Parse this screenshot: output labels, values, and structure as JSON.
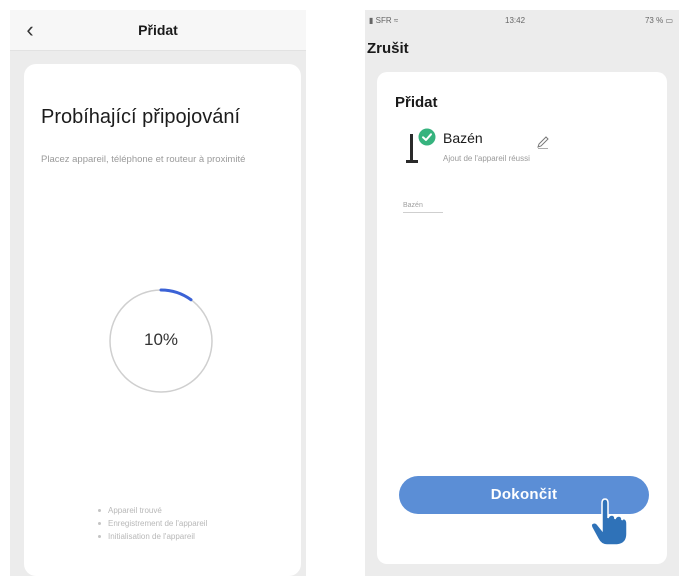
{
  "left_screen": {
    "back_icon": "chevron-left-icon",
    "header_title": "Přidat",
    "heading": "Probíhající připojování",
    "subtitle": "Placez appareil, téléphone et routeur à proximité",
    "progress_percent": 10,
    "progress_label": "10%",
    "progress_color": "#3b62d6",
    "steps": [
      "Appareil trouvé",
      "Enregistrement de l'appareil",
      "Initialisation de l'appareil"
    ]
  },
  "right_screen": {
    "status": {
      "carrier": "SFR",
      "time": "13:42",
      "battery": "73 %"
    },
    "cancel_label": "Zrušit",
    "add_title": "Přidat",
    "device": {
      "icon": "pool-lamp-icon",
      "name": "Bazén",
      "status": "Ajout de l'appareil réussi",
      "success_color": "#36b37e"
    },
    "room_label": "Bazén",
    "done_label": "Dokončit",
    "done_color": "#5b8ed6"
  }
}
